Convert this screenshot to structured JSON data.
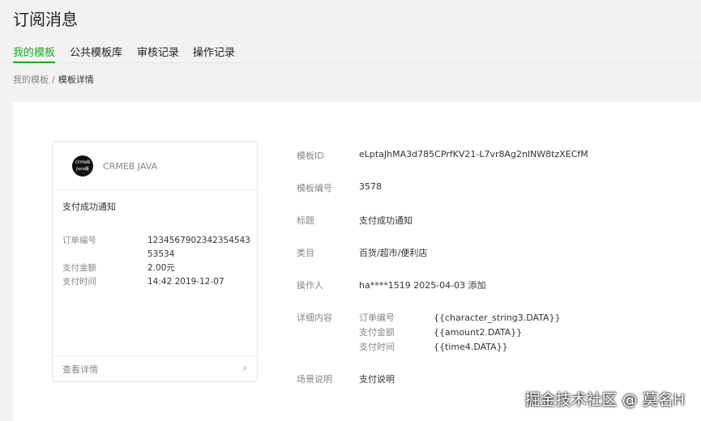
{
  "page_title": "订阅消息",
  "tabs": [
    {
      "label": "我的模板",
      "active": true
    },
    {
      "label": "公共模板库",
      "active": false
    },
    {
      "label": "审核记录",
      "active": false
    },
    {
      "label": "操作记录",
      "active": false
    }
  ],
  "breadcrumb": {
    "parent": "我的模板",
    "separator": "/",
    "current": "模板详情"
  },
  "card": {
    "logo_line1": "crmeb",
    "logo_line2": "Java版",
    "account_name": "CRMEB JAVA",
    "title": "支付成功通知",
    "rows": [
      {
        "key": "订单编号",
        "value": "123456790234235454353534"
      },
      {
        "key": "支付金额",
        "value": "2.00元"
      },
      {
        "key": "支付时间",
        "value": "14:42 2019-12-07"
      }
    ],
    "footer_label": "查看详情",
    "chevron": "›"
  },
  "details": {
    "template_id": {
      "key": "模板ID",
      "value": "eLptaJhMA3d785CPrfKV21-L7vr8Ag2nlNW8tzXECfM"
    },
    "template_no": {
      "key": "模板编号",
      "value": "3578"
    },
    "title": {
      "key": "标题",
      "value": "支付成功通知"
    },
    "category": {
      "key": "类目",
      "value": "百货/超市/便利店"
    },
    "operator": {
      "key": "操作人",
      "value": "ha****1519 2025-04-03 添加"
    },
    "content": {
      "key": "详细内容",
      "items": [
        {
          "key": "订单编号",
          "value": "{{character_string3.DATA}}"
        },
        {
          "key": "支付金额",
          "value": "{{amount2.DATA}}"
        },
        {
          "key": "支付时间",
          "value": "{{time4.DATA}}"
        }
      ]
    },
    "scene": {
      "key": "场景说明",
      "value": "支付说明"
    }
  },
  "watermark": "掘金技术社区 @ 莫名H",
  "colors": {
    "accent": "#1aad19",
    "background": "#f2f2f2"
  }
}
